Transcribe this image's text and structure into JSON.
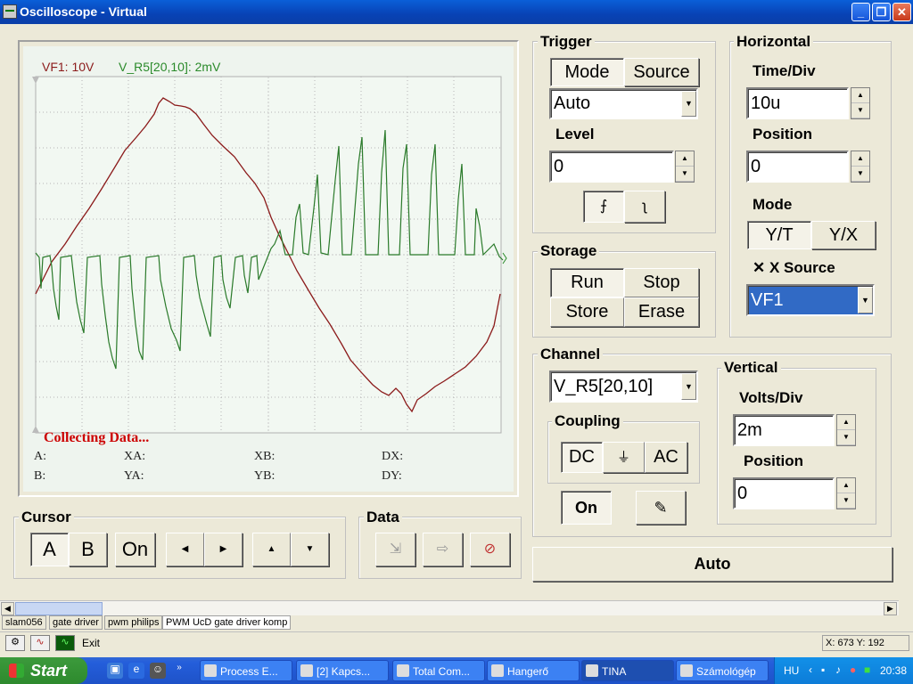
{
  "window": {
    "title": "Oscilloscope - Virtual"
  },
  "display": {
    "channel_a_label": "VF1: 10V",
    "channel_b_label": "V_R5[20,10]: 2mV",
    "status": "Collecting Data...",
    "readouts": {
      "a": "A:",
      "b": "B:",
      "xa": "XA:",
      "ya": "YA:",
      "xb": "XB:",
      "yb": "YB:",
      "dx": "DX:",
      "dy": "DY:"
    },
    "colors": {
      "channel_a": "#8b1a1a",
      "channel_b": "#2a8a2a",
      "status": "#cc0000"
    }
  },
  "trigger": {
    "title": "Trigger",
    "mode_label": "Mode",
    "source_label": "Source",
    "mode_value": "Auto",
    "level_label": "Level",
    "level_value": "0",
    "rising_edge_icon": "rising-edge-icon",
    "falling_edge_icon": "falling-edge-icon"
  },
  "horizontal": {
    "title": "Horizontal",
    "time_div_label": "Time/Div",
    "time_div_value": "10u",
    "position_label": "Position",
    "position_value": "0",
    "mode_label": "Mode",
    "yt_label": "Y/T",
    "yx_label": "Y/X",
    "x_source_label": "X Source",
    "x_source_value": "VF1"
  },
  "storage": {
    "title": "Storage",
    "run": "Run",
    "stop": "Stop",
    "store": "Store",
    "erase": "Erase"
  },
  "channel": {
    "title": "Channel",
    "value": "V_R5[20,10]",
    "coupling_label": "Coupling",
    "dc": "DC",
    "gnd": "⏚",
    "ac": "AC",
    "on": "On"
  },
  "vertical": {
    "title": "Vertical",
    "volts_div_label": "Volts/Div",
    "volts_div_value": "2m",
    "position_label": "Position",
    "position_value": "0"
  },
  "auto_button": "Auto",
  "cursor": {
    "title": "Cursor",
    "a": "A",
    "b": "B",
    "on": "On"
  },
  "data_group": {
    "title": "Data"
  },
  "tabs": [
    "slam056",
    "gate driver",
    "pwm philips",
    "PWM UcD gate driver komp"
  ],
  "status_bar": {
    "exit": "Exit",
    "coords": "X: 673  Y: 192"
  },
  "taskbar": {
    "start": "Start",
    "tasks": [
      "Process E...",
      "[2] Kapcs...",
      "Total Com...",
      "Hangerő",
      "TINA",
      "Számológép"
    ],
    "lang": "HU",
    "clock": "20:38"
  }
}
